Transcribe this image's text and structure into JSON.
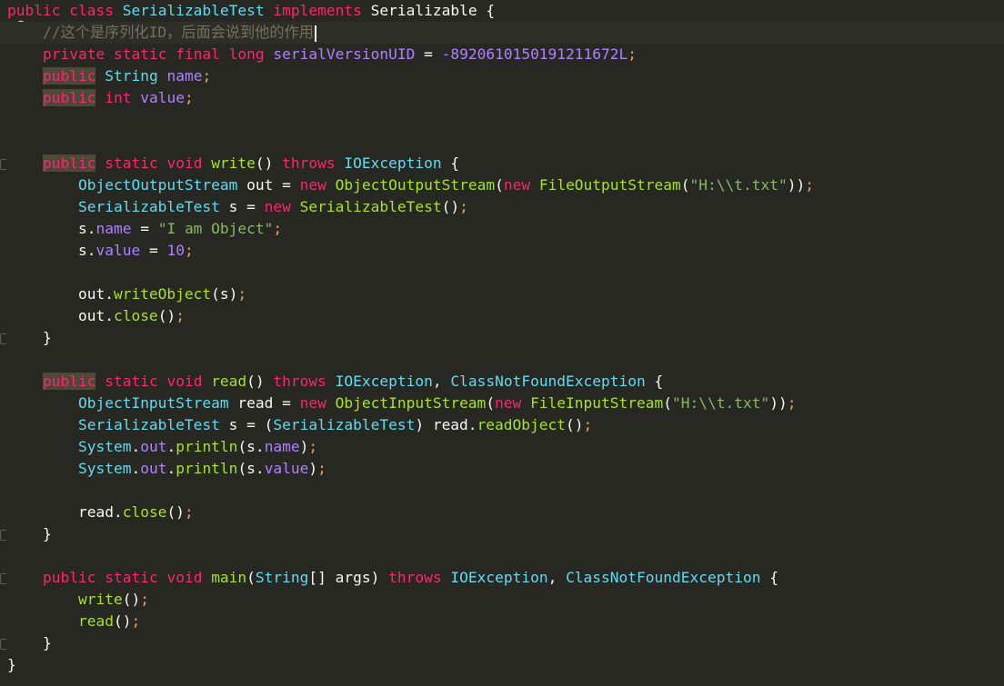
{
  "editor": {
    "lines": [
      [
        [
          "k",
          "public"
        ],
        [
          "v",
          " "
        ],
        [
          "k",
          "class"
        ],
        [
          "v",
          " "
        ],
        [
          "t",
          "SerializableTest"
        ],
        [
          "v",
          " "
        ],
        [
          "k",
          "implements"
        ],
        [
          "v",
          " "
        ],
        [
          "v",
          "Serializable"
        ],
        [
          "v",
          " {"
        ]
      ],
      [
        [
          "v",
          "    "
        ],
        [
          "c",
          "//这个是序列化ID，后面会说到他的作用"
        ]
      ],
      [
        [
          "v",
          "    "
        ],
        [
          "k",
          "private"
        ],
        [
          "v",
          " "
        ],
        [
          "k",
          "static"
        ],
        [
          "v",
          " "
        ],
        [
          "k",
          "final"
        ],
        [
          "v",
          " "
        ],
        [
          "k",
          "long"
        ],
        [
          "v",
          " "
        ],
        [
          "n",
          "serialVersionUID"
        ],
        [
          "v",
          " = "
        ],
        [
          "n",
          "-8920610150191211672L"
        ],
        [
          "p",
          ";"
        ]
      ],
      [
        [
          "v",
          "    "
        ],
        [
          "k",
          "public"
        ],
        [
          "v",
          " "
        ],
        [
          "t",
          "String"
        ],
        [
          "v",
          " "
        ],
        [
          "n",
          "name"
        ],
        [
          "p",
          ";"
        ]
      ],
      [
        [
          "v",
          "    "
        ],
        [
          "k",
          "public"
        ],
        [
          "v",
          " "
        ],
        [
          "k",
          "int"
        ],
        [
          "v",
          " "
        ],
        [
          "n",
          "value"
        ],
        [
          "p",
          ";"
        ]
      ],
      [],
      [],
      [
        [
          "v",
          "    "
        ],
        [
          "k",
          "public"
        ],
        [
          "v",
          " "
        ],
        [
          "k",
          "static"
        ],
        [
          "v",
          " "
        ],
        [
          "k",
          "void"
        ],
        [
          "v",
          " "
        ],
        [
          "f",
          "write"
        ],
        [
          "v",
          "() "
        ],
        [
          "k",
          "throws"
        ],
        [
          "v",
          " "
        ],
        [
          "t",
          "IOException"
        ],
        [
          "v",
          " {"
        ]
      ],
      [
        [
          "v",
          "        "
        ],
        [
          "t",
          "ObjectOutputStream"
        ],
        [
          "v",
          " out = "
        ],
        [
          "k",
          "new"
        ],
        [
          "v",
          " "
        ],
        [
          "f",
          "ObjectOutputStream"
        ],
        [
          "v",
          "("
        ],
        [
          "k",
          "new"
        ],
        [
          "v",
          " "
        ],
        [
          "f",
          "FileOutputStream"
        ],
        [
          "v",
          "("
        ],
        [
          "s",
          "\"H:\\\\t.txt\""
        ],
        [
          "v",
          "))"
        ],
        [
          "p",
          ";"
        ]
      ],
      [
        [
          "v",
          "        "
        ],
        [
          "t",
          "SerializableTest"
        ],
        [
          "v",
          " s = "
        ],
        [
          "k",
          "new"
        ],
        [
          "v",
          " "
        ],
        [
          "f",
          "SerializableTest"
        ],
        [
          "v",
          "()"
        ],
        [
          "p",
          ";"
        ]
      ],
      [
        [
          "v",
          "        s."
        ],
        [
          "n",
          "name"
        ],
        [
          "v",
          " = "
        ],
        [
          "s",
          "\"I am Object\""
        ],
        [
          "p",
          ";"
        ]
      ],
      [
        [
          "v",
          "        s."
        ],
        [
          "n",
          "value"
        ],
        [
          "v",
          " = "
        ],
        [
          "n",
          "10"
        ],
        [
          "p",
          ";"
        ]
      ],
      [],
      [
        [
          "v",
          "        out."
        ],
        [
          "f",
          "writeObject"
        ],
        [
          "v",
          "(s)"
        ],
        [
          "p",
          ";"
        ]
      ],
      [
        [
          "v",
          "        out."
        ],
        [
          "f",
          "close"
        ],
        [
          "v",
          "()"
        ],
        [
          "p",
          ";"
        ]
      ],
      [
        [
          "v",
          "    }"
        ]
      ],
      [],
      [
        [
          "v",
          "    "
        ],
        [
          "k",
          "public"
        ],
        [
          "v",
          " "
        ],
        [
          "k",
          "static"
        ],
        [
          "v",
          " "
        ],
        [
          "k",
          "void"
        ],
        [
          "v",
          " "
        ],
        [
          "f",
          "read"
        ],
        [
          "v",
          "() "
        ],
        [
          "k",
          "throws"
        ],
        [
          "v",
          " "
        ],
        [
          "t",
          "IOException"
        ],
        [
          "v",
          ", "
        ],
        [
          "t",
          "ClassNotFoundException"
        ],
        [
          "v",
          " {"
        ]
      ],
      [
        [
          "v",
          "        "
        ],
        [
          "t",
          "ObjectInputStream"
        ],
        [
          "v",
          " read = "
        ],
        [
          "k",
          "new"
        ],
        [
          "v",
          " "
        ],
        [
          "f",
          "ObjectInputStream"
        ],
        [
          "v",
          "("
        ],
        [
          "k",
          "new"
        ],
        [
          "v",
          " "
        ],
        [
          "f",
          "FileInputStream"
        ],
        [
          "v",
          "("
        ],
        [
          "s",
          "\"H:\\\\t.txt\""
        ],
        [
          "v",
          "))"
        ],
        [
          "p",
          ";"
        ]
      ],
      [
        [
          "v",
          "        "
        ],
        [
          "t",
          "SerializableTest"
        ],
        [
          "v",
          " s = ("
        ],
        [
          "t",
          "SerializableTest"
        ],
        [
          "v",
          ") read."
        ],
        [
          "f",
          "readObject"
        ],
        [
          "v",
          "()"
        ],
        [
          "p",
          ";"
        ]
      ],
      [
        [
          "v",
          "        "
        ],
        [
          "t",
          "System"
        ],
        [
          "v",
          "."
        ],
        [
          "n",
          "out"
        ],
        [
          "v",
          "."
        ],
        [
          "f",
          "println"
        ],
        [
          "v",
          "(s."
        ],
        [
          "n",
          "name"
        ],
        [
          "v",
          ")"
        ],
        [
          "p",
          ";"
        ]
      ],
      [
        [
          "v",
          "        "
        ],
        [
          "t",
          "System"
        ],
        [
          "v",
          "."
        ],
        [
          "n",
          "out"
        ],
        [
          "v",
          "."
        ],
        [
          "f",
          "println"
        ],
        [
          "v",
          "(s."
        ],
        [
          "n",
          "value"
        ],
        [
          "v",
          ")"
        ],
        [
          "p",
          ";"
        ]
      ],
      [],
      [
        [
          "v",
          "        read."
        ],
        [
          "f",
          "close"
        ],
        [
          "v",
          "()"
        ],
        [
          "p",
          ";"
        ]
      ],
      [
        [
          "v",
          "    }"
        ]
      ],
      [],
      [
        [
          "v",
          "    "
        ],
        [
          "k",
          "public"
        ],
        [
          "v",
          " "
        ],
        [
          "k",
          "static"
        ],
        [
          "v",
          " "
        ],
        [
          "k",
          "void"
        ],
        [
          "v",
          " "
        ],
        [
          "f",
          "main"
        ],
        [
          "v",
          "("
        ],
        [
          "t",
          "String"
        ],
        [
          "v",
          "[] args) "
        ],
        [
          "k",
          "throws"
        ],
        [
          "v",
          " "
        ],
        [
          "t",
          "IOException"
        ],
        [
          "v",
          ", "
        ],
        [
          "t",
          "ClassNotFoundException"
        ],
        [
          "v",
          " {"
        ]
      ],
      [
        [
          "v",
          "        "
        ],
        [
          "f",
          "write"
        ],
        [
          "v",
          "()"
        ],
        [
          "p",
          ";"
        ]
      ],
      [
        [
          "v",
          "        "
        ],
        [
          "f",
          "read"
        ],
        [
          "v",
          "()"
        ],
        [
          "p",
          ";"
        ]
      ],
      [
        [
          "v",
          "    }"
        ]
      ],
      [
        [
          "v",
          "}"
        ]
      ]
    ],
    "highlighted_public_lines": [
      3,
      4,
      7,
      17
    ],
    "current_line": 1,
    "gutter_icons": {
      "bulb_line": 1,
      "fold_lines": [
        7,
        15,
        24,
        26,
        29
      ]
    }
  }
}
